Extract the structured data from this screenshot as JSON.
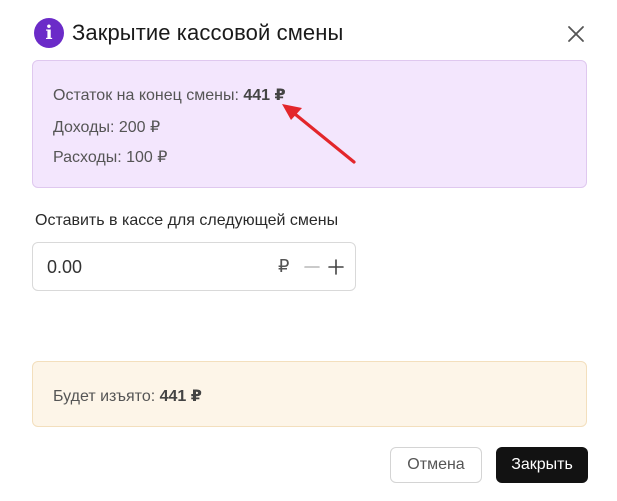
{
  "dialog": {
    "title": "Закрытие кассовой смены",
    "info_icon_glyph": "i",
    "info_icon": "info-icon",
    "close_icon": "close-icon",
    "accent_color": "#6b2bc8"
  },
  "summary": {
    "ending_balance_label": "Остаток на конец смены:",
    "ending_balance_value": "441 ₽",
    "income_text": "Доходы: 200 ₽",
    "expenses_text": "Расходы: 100 ₽",
    "background_color": "#f3e6fd",
    "annotation_arrow_color": "#e3262b"
  },
  "keep_in_register": {
    "label": "Оставить в кассе для следующей смены",
    "value": "0.00",
    "currency": "₽",
    "minus_icon": "minus-icon",
    "plus_icon": "plus-icon"
  },
  "withdrawal": {
    "label": "Будет изъято:",
    "value": "441 ₽",
    "background_color": "#fdf5e8"
  },
  "actions": {
    "cancel_label": "Отмена",
    "close_label": "Закрыть"
  }
}
